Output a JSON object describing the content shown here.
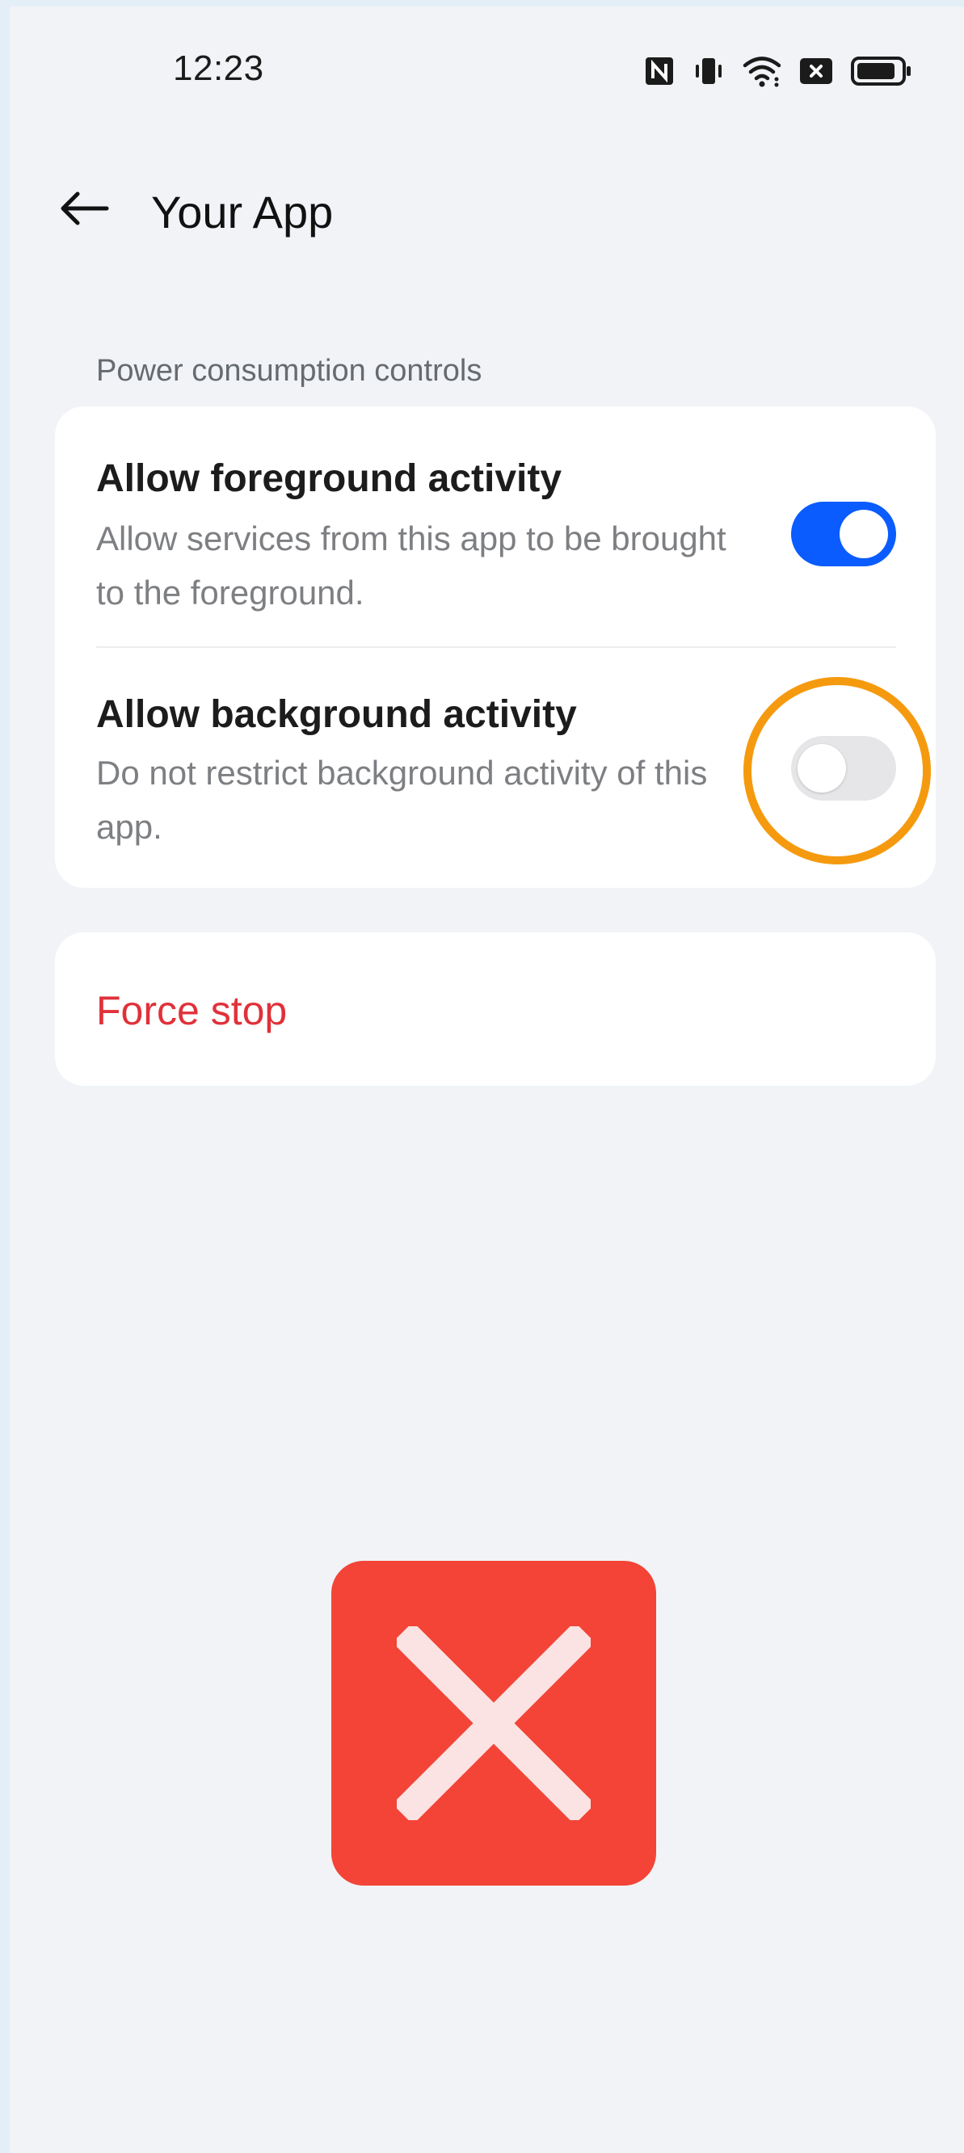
{
  "status_bar": {
    "time": "12:23",
    "icons": [
      "nfc-icon",
      "vibrate-icon",
      "wifi-icon",
      "notification-x-icon",
      "battery-icon"
    ]
  },
  "app_bar": {
    "title": "Your App",
    "back_icon": "back-arrow-icon"
  },
  "section": {
    "header": "Power consumption controls"
  },
  "settings": [
    {
      "title": "Allow foreground activity",
      "description": "Allow services from this app to be brought to the foreground.",
      "enabled": true
    },
    {
      "title": "Allow background activity",
      "description": "Do not restrict background activity of this app.",
      "enabled": false
    }
  ],
  "force_stop": {
    "label": "Force stop"
  },
  "colors": {
    "toggle_on": "#0a5cff",
    "toggle_off": "#e6e6e9",
    "force_stop": "#e0313a",
    "highlight": "#f59a0f",
    "error_mark": "#f34437"
  }
}
